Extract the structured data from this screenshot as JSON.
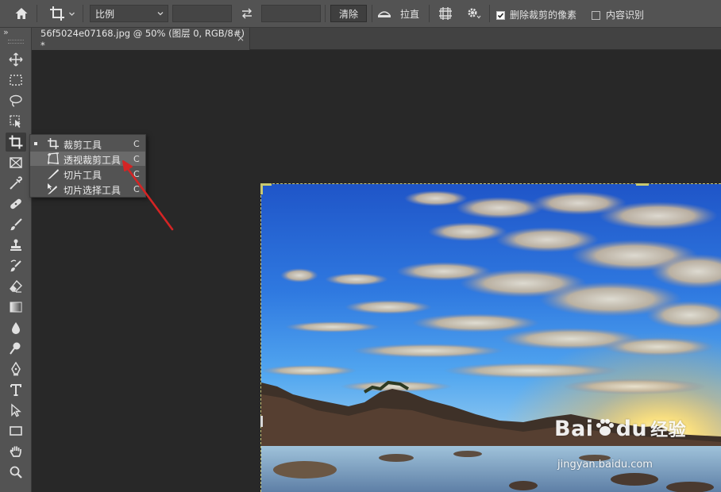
{
  "options_bar": {
    "ratio_select": "比例",
    "clear_button": "清除",
    "straighten_label": "拉直",
    "delete_cropped_pixels": {
      "label": "删除裁剪的像素",
      "checked": true
    },
    "content_aware": {
      "label": "内容识别",
      "checked": false
    }
  },
  "document_tab": {
    "title": "56f5024e07168.jpg @ 50% (图层 0, RGB/8#) *",
    "close": "×"
  },
  "toolbar": {
    "collapse_glyph": "»",
    "tools": [
      "move-icon",
      "rect-marquee-icon",
      "lasso-icon",
      "object-select-icon",
      "crop-icon",
      "frame-icon",
      "eyedropper-icon",
      "healing-brush-icon",
      "brush-icon",
      "clone-stamp-icon",
      "history-brush-icon",
      "eraser-icon",
      "gradient-icon",
      "blur-icon",
      "dodge-icon",
      "pen-icon",
      "type-icon",
      "path-select-icon",
      "rectangle-icon",
      "hand-icon",
      "zoom-icon"
    ]
  },
  "crop_flyout": {
    "items": [
      {
        "label": "裁剪工具",
        "shortcut": "C",
        "current": true,
        "icon": "crop-icon"
      },
      {
        "label": "透视裁剪工具",
        "shortcut": "C",
        "current": false,
        "highlighted": true,
        "icon": "perspective-crop-icon"
      },
      {
        "label": "切片工具",
        "shortcut": "C",
        "current": false,
        "icon": "slice-icon"
      },
      {
        "label": "切片选择工具",
        "shortcut": "C",
        "current": false,
        "icon": "slice-select-icon"
      }
    ]
  },
  "watermark": {
    "logo_text": "Bai",
    "logo_text_2": "du",
    "logo_text_cn": "经验",
    "url": "jingyan.baidu.com"
  },
  "colors": {
    "annotation_arrow": "#d42424",
    "ui_panel": "#535353",
    "workspace": "#282828"
  }
}
